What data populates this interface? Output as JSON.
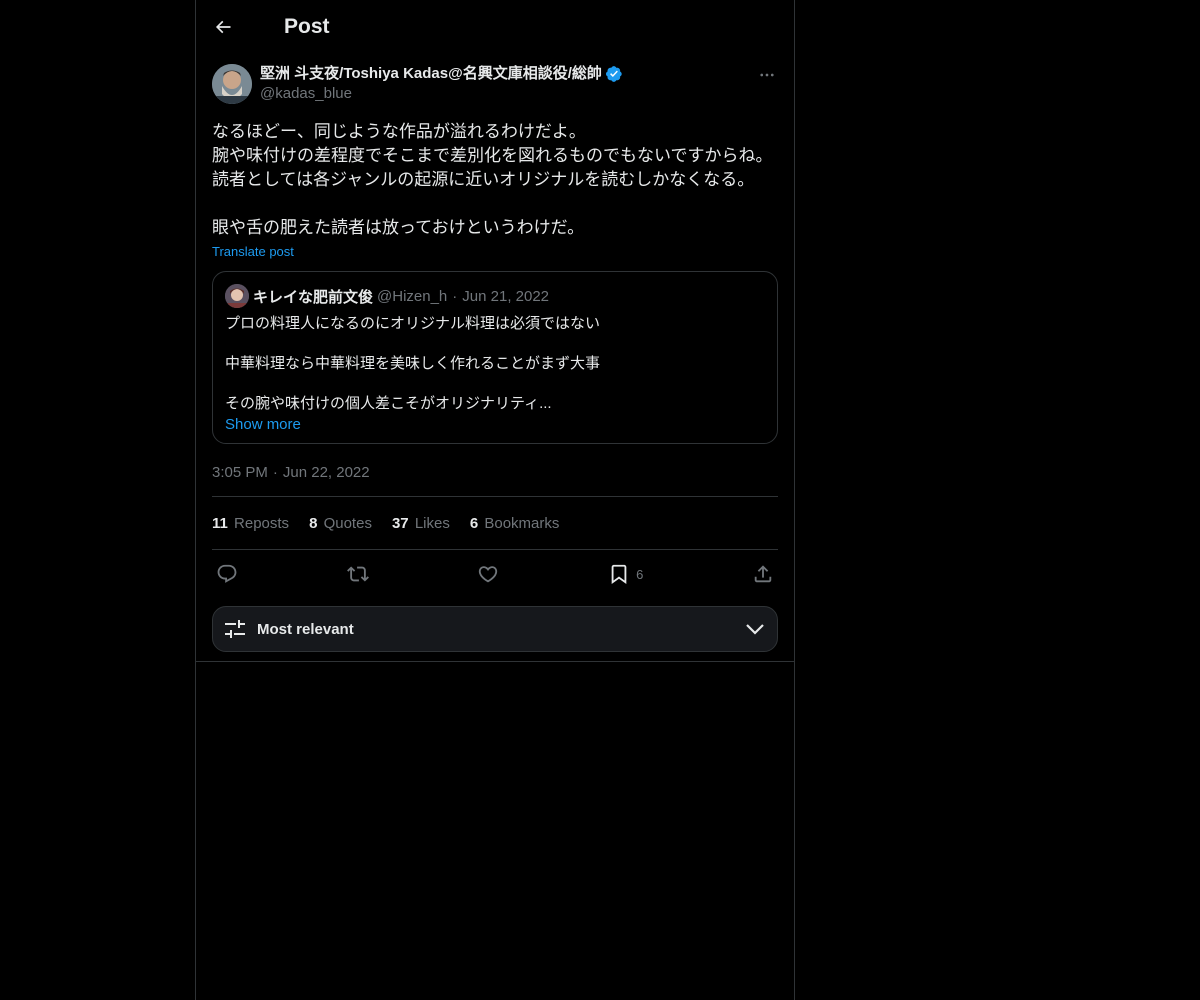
{
  "header": {
    "title": "Post"
  },
  "author": {
    "display_name": "堅洲 斗支夜/Toshiya Kadas@名興文庫相談役/総帥",
    "handle": "@kadas_blue"
  },
  "post": {
    "text": "なるほどー、同じような作品が溢れるわけだよ。\n腕や味付けの差程度でそこまで差別化を図れるものでもないですからね。\n読者としては各ジャンルの起源に近いオリジナルを読むしかなくなる。\n\n眼や舌の肥えた読者は放っておけというわけだ。",
    "translate_label": "Translate post",
    "time": "3:05 PM",
    "date": "Jun 22, 2022"
  },
  "quote": {
    "display_name": "キレイな肥前文俊",
    "handle": "@Hizen_h",
    "date": "Jun 21, 2022",
    "text": "プロの料理人になるのにオリジナル料理は必須ではない\n\n中華料理なら中華料理を美味しく作れることがまず大事\n\nその腕や味付けの個人差こそがオリジナリティ...",
    "show_more": "Show more"
  },
  "stats": {
    "reposts_count": "11",
    "reposts_label": "Reposts",
    "quotes_count": "8",
    "quotes_label": "Quotes",
    "likes_count": "37",
    "likes_label": "Likes",
    "bookmarks_count": "6",
    "bookmarks_label": "Bookmarks"
  },
  "actions": {
    "reply_icon": "reply-icon",
    "repost_icon": "repost-icon",
    "like_icon": "heart-icon",
    "bookmark_icon": "bookmark-icon",
    "bookmark_count": "6",
    "share_icon": "share-icon"
  },
  "sort": {
    "label": "Most relevant"
  },
  "colors": {
    "accent": "#1d9bf0",
    "background": "#000000",
    "muted": "#71767b",
    "border": "#2f3336"
  }
}
